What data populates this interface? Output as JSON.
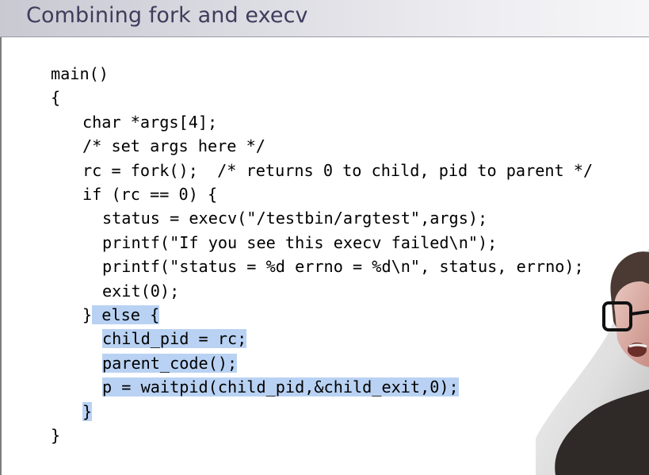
{
  "slide": {
    "title": "Combining fork and execv"
  },
  "code_lines": [
    {
      "pre": "main()",
      "hl": "",
      "indent": 0
    },
    {
      "pre": "{",
      "hl": "",
      "indent": 0
    },
    {
      "pre": "char *args[4];",
      "hl": "",
      "indent": 1
    },
    {
      "pre": "/* set args here */",
      "hl": "",
      "indent": 1
    },
    {
      "pre": "rc = fork();  /* returns 0 to child, pid to parent */",
      "hl": "",
      "indent": 1
    },
    {
      "pre": "if (rc == 0) {",
      "hl": "",
      "indent": 1
    },
    {
      "pre": "status = execv(\"/testbin/argtest\",args);",
      "hl": "",
      "indent": 2
    },
    {
      "pre": "printf(\"If you see this execv failed\\n\");",
      "hl": "",
      "indent": 2
    },
    {
      "pre": "printf(\"status = %d errno = %d\\n\", status, errno);",
      "hl": "",
      "indent": 2
    },
    {
      "pre": "exit(0);",
      "hl": "",
      "indent": 2
    },
    {
      "pre": "}",
      "hl": " else {",
      "indent": 1
    },
    {
      "pre": "",
      "hl": "child_pid = rc;",
      "indent": 2
    },
    {
      "pre": "",
      "hl": "parent_code();",
      "indent": 2
    },
    {
      "pre": "",
      "hl": "p = waitpid(child_pid,&child_exit,0);",
      "indent": 2
    },
    {
      "pre": "",
      "hl": "}",
      "indent": 1
    },
    {
      "pre": "}",
      "hl": "",
      "indent": 0
    }
  ],
  "text_cursor_glyph": "I"
}
